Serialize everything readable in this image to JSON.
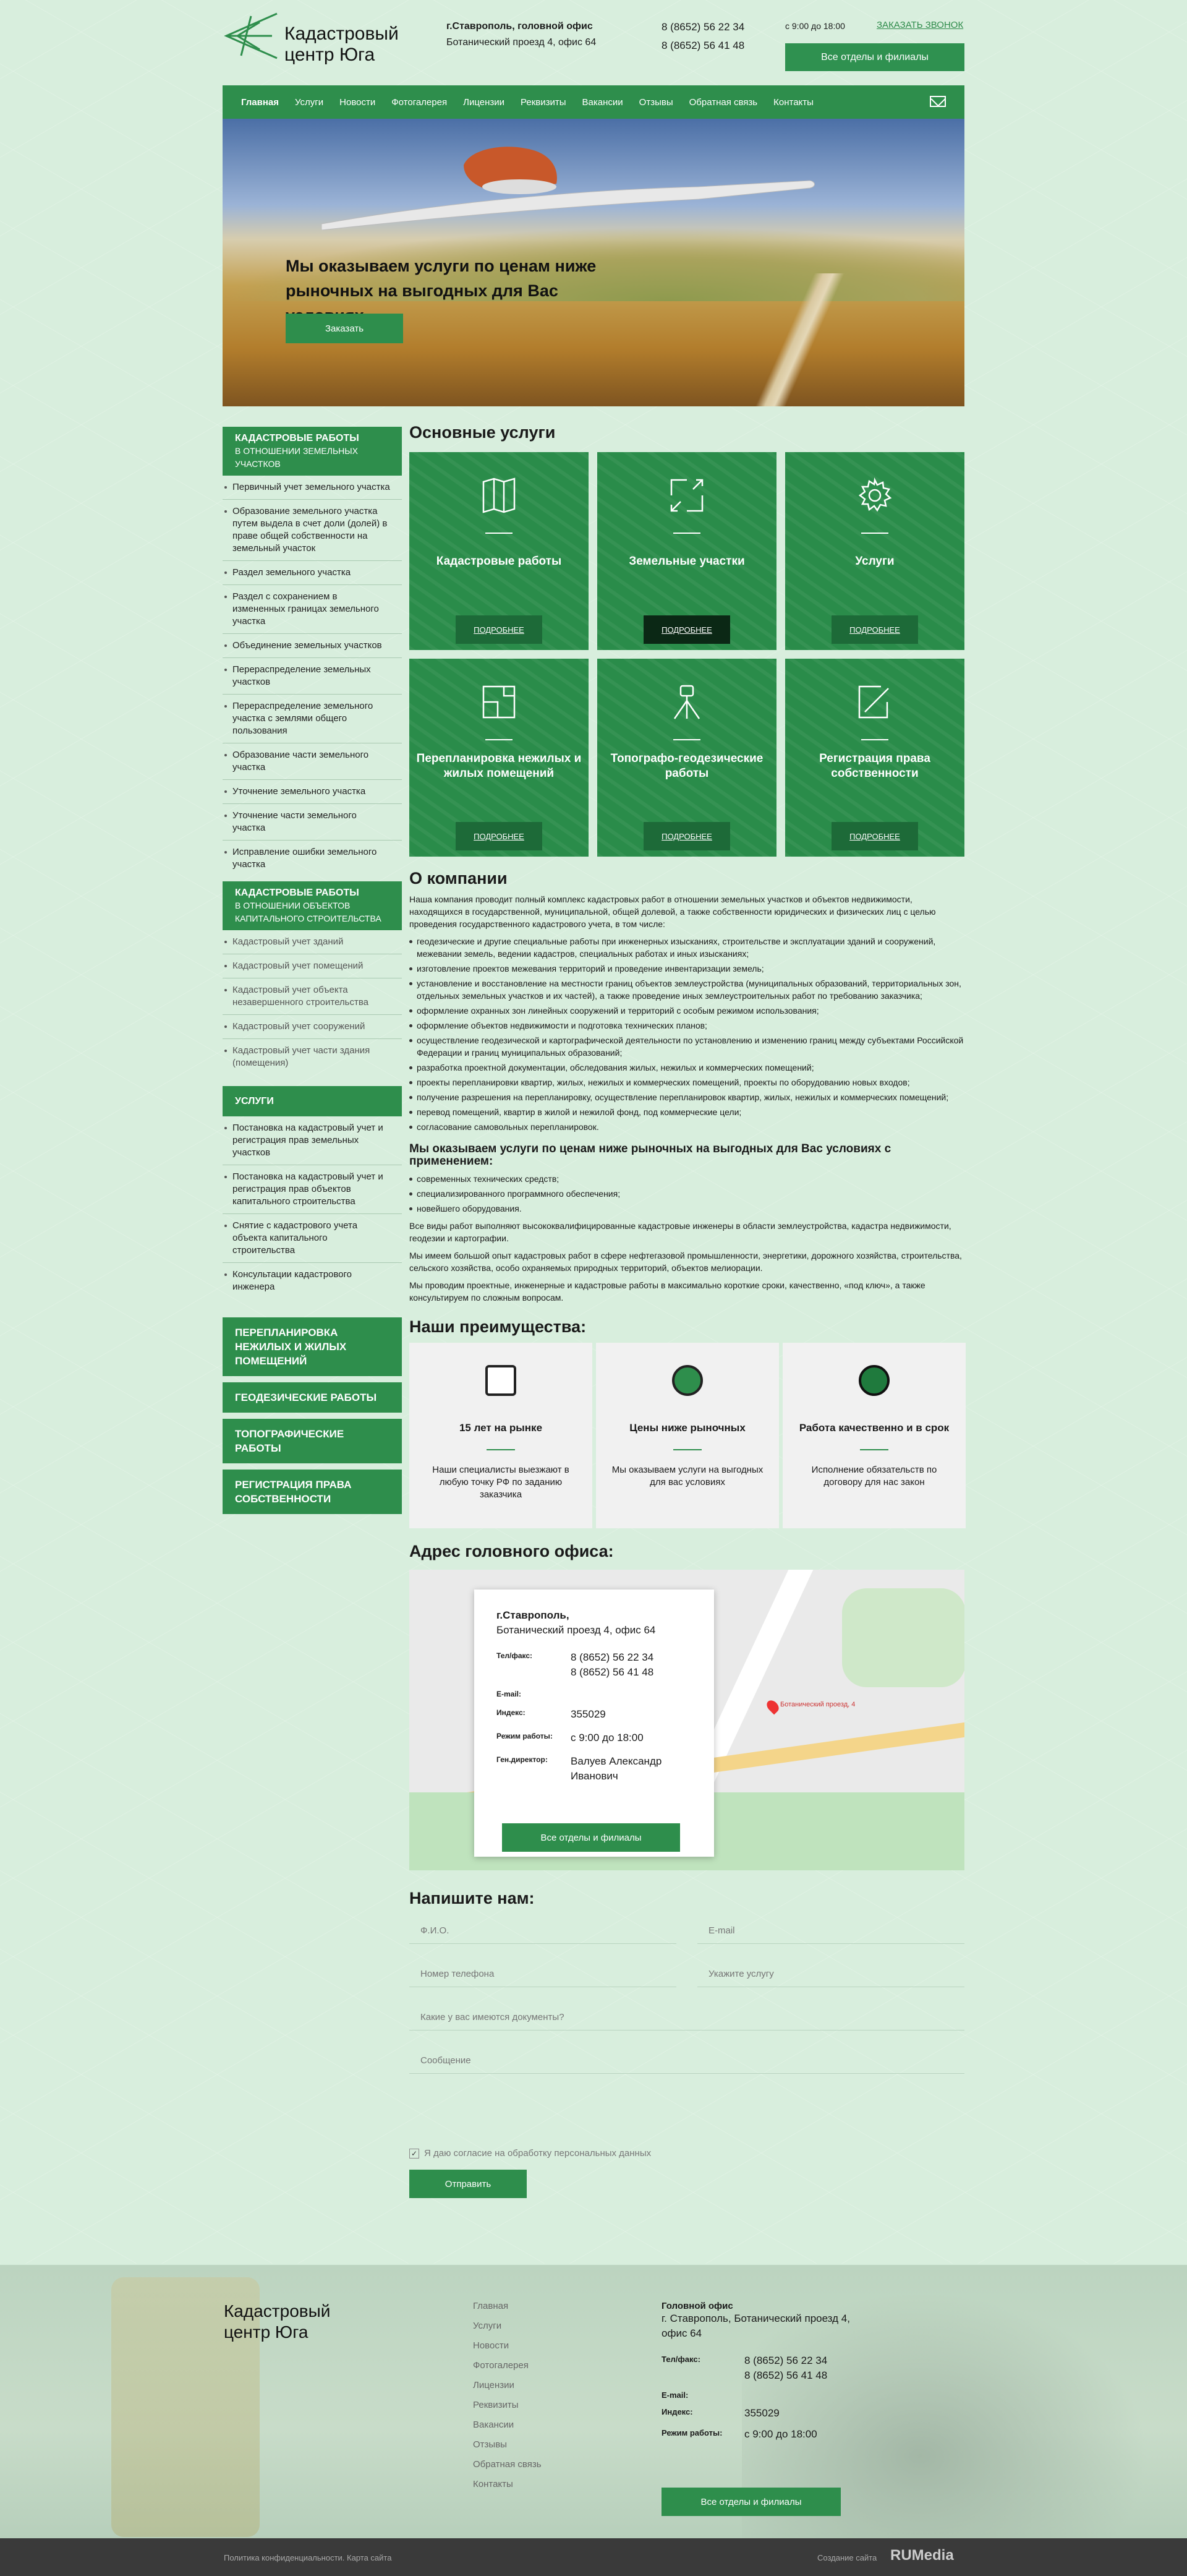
{
  "header": {
    "logo_line1": "Кадастровый",
    "logo_line2": "центр Юга",
    "city": "г.Ставрополь, головной офис",
    "address": "Ботанический проезд 4, офис 64",
    "phone1": "8 (8652) 56 22 34",
    "phone2": "8 (8652) 56 41 48",
    "hours": "с 9:00 до 18:00",
    "call_link": "ЗАКАЗАТЬ ЗВОНОК",
    "branches_button": "Все отделы и филиалы"
  },
  "nav": [
    "Главная",
    "Услуги",
    "Новости",
    "Фотогалерея",
    "Лицензии",
    "Реквизиты",
    "Вакансии",
    "Отзывы",
    "Обратная связь",
    "Контакты"
  ],
  "hero": {
    "text": "Мы оказываем услуги по ценам ниже рыночных на выгодных для Вас условиях",
    "button": "Заказать"
  },
  "sidebar": {
    "group1_title": "Кадастровые работы",
    "group1_sub": "в отношении земельных участков",
    "group1_items": [
      "Первичный учет земельного участка",
      "Образование земельного участка путем выдела в счет доли (долей) в праве общей собственности на земельный участок",
      "Раздел земельного участка",
      "Раздел с сохранением в измененных границах земельного участка",
      "Объединение земельных участков",
      "Перераспределение земельных участков",
      "Перераспределение земельного участка с землями общего пользования",
      "Образование части земельного участка",
      "Уточнение земельного участка",
      "Уточнение части земельного участка",
      "Исправление ошибки земельного участка"
    ],
    "group2_title": "Кадастровые работы",
    "group2_sub": "в отношении объектов капитального строительства",
    "group2_items": [
      "Кадастровый учет зданий",
      "Кадастровый учет помещений",
      "Кадастровый учет объекта незавершенного строительства",
      "Кадастровый учет сооружений",
      "Кадастровый учет части здания (помещения)"
    ],
    "group3_title": "Услуги",
    "group3_items": [
      "Постановка на кадастровый учет и регистрация прав земельных участков",
      "Постановка на кадастровый учет и регистрация прав объектов капитального строительства",
      "Снятие с кадастрового учета объекта капитального строительства",
      "Консультации кадастрового инженера"
    ],
    "big_links": [
      "Перепланировка нежилых и жилых помещений",
      "Геодезические работы",
      "Топографические работы",
      "Регистрация права собственности"
    ]
  },
  "services": {
    "title": "Основные услуги",
    "more": "ПОДРОБНЕЕ",
    "cards": [
      {
        "title": "Кадастровые работы",
        "icon": "map-icon"
      },
      {
        "title": "Земельные участки",
        "icon": "plot-arrows-icon"
      },
      {
        "title": "Услуги",
        "icon": "gear-icon"
      },
      {
        "title": "Перепланировка нежилых и жилых помещений",
        "icon": "floorplan-icon"
      },
      {
        "title": "Топографо-геодезические работы",
        "icon": "theodolite-icon"
      },
      {
        "title": "Регистрация права собственности",
        "icon": "document-pen-icon"
      }
    ]
  },
  "about": {
    "title": "О компании",
    "intro": "Наша компания проводит полный комплекс кадастровых работ в отношении земельных участков и объектов недвижимости, находящихся в государственной, муниципальной, общей долевой, а также собственности юридических и физических лиц с целью проведения государственного кадастрового учета, в том числе:",
    "list1": [
      "геодезические и другие специальные работы при инженерных изысканиях, строительстве и эксплуатации зданий и сооружений, межевании земель, ведении кадастров, специальных работах и иных изысканиях;",
      "изготовление проектов межевания территорий и проведение инвентаризации земель;",
      "установление и восстановление на местности границ объектов землеустройства (муниципальных образований, территориальных зон, отдельных земельных участков и их частей), а также проведение иных землеустроительных работ по требованию заказчика;",
      "оформление охранных зон линейных сооружений и территорий с особым режимом использования;",
      "оформление объектов недвижимости и подготовка технических планов;",
      "осуществление геодезической и картографической деятельности по установлению и изменению границ между субъектами Российской Федерации и границ муниципальных образований;",
      "разработка проектной документации, обследования жилых, нежилых и коммерческих помещений;",
      "проекты перепланировки квартир, жилых, нежилых и коммерческих помещений, проекты по оборудованию новых входов;",
      "получение разрешения на перепланировку, осуществление перепланировок квартир, жилых, нежилых и коммерческих помещений;",
      "перевод помещений, квартир в жилой и нежилой фонд, под коммерческие цели;",
      "согласование самовольных перепланировок."
    ],
    "subtitle": "Мы оказываем услуги по ценам ниже рыночных на выгодных для Вас условиях с применением:",
    "list2": [
      "современных технических средств;",
      "специализированного программного обеспечения;",
      "новейшего оборудования."
    ],
    "p1": "Все виды работ выполняют высококвалифицированные кадастровые инженеры в области землеустройства, кадастра недвижимости, геодезии и картографии.",
    "p2": "Мы имеем большой опыт кадастровых работ в сфере нефтегазовой промышленности, энергетики, дорожного хозяйства, строительства, сельского хозяйства, особо охраняемых природных территорий, объектов мелиорации.",
    "p3": "Мы проводим проектные, инженерные и кадастровые работы в максимально короткие сроки, качественно, «под ключ», а также консультируем по сложным вопросам."
  },
  "advantages": {
    "title": "Наши преимущества:",
    "items": [
      {
        "title": "15 лет на рынке",
        "desc": "Наши специалисты выезжают в любую точку РФ по заданию заказчика",
        "icon": "calendar-icon"
      },
      {
        "title": "Цены ниже рыночных",
        "desc": "Мы оказываем услуги на выгодных для вас условиях",
        "icon": "calculator-icon"
      },
      {
        "title": "Работа качественно и в срок",
        "desc": "Исполнение обязательств по договору для нас закон",
        "icon": "clock-icon"
      }
    ]
  },
  "office": {
    "title": "Адрес головного офиса:",
    "city": "г.Ставрополь,",
    "address": "Ботанический проезд 4, офис 64",
    "phone_label": "Тел/факс:",
    "phone1": "8 (8652) 56 22 34",
    "phone2": "8 (8652) 56 41 48",
    "email_label": "E-mail:",
    "index_label": "Индекс:",
    "index": "355029",
    "hours_label": "Режим работы:",
    "hours": "с 9:00 до 18:00",
    "director_label": "Ген.директор:",
    "director": "Валуев Александр Иванович",
    "button": "Все отделы и филиалы",
    "map_label": "Ботанический проезд, 4"
  },
  "form": {
    "title": "Напишите нам:",
    "name_ph": "Ф.И.О.",
    "email_ph": "E-mail",
    "phone_ph": "Номер телефона",
    "service_ph": "Укажите услугу",
    "docs_ph": "Какие у вас имеются документы?",
    "message_ph": "Сообщение",
    "consent": "Я даю согласие на обработку персональных данных",
    "submit": "Отправить"
  },
  "footer": {
    "logo_line1": "Кадастровый",
    "logo_line2": "центр Юга",
    "nav": [
      "Главная",
      "Услуги",
      "Новости",
      "Фотогалерея",
      "Лицензии",
      "Реквизиты",
      "Вакансии",
      "Отзывы",
      "Обратная связь",
      "Контакты"
    ],
    "office_title": "Головной офис",
    "office_address": "г. Ставрополь, Ботанический проезд 4, офис 64",
    "phone_label": "Тел/факс:",
    "phone1": "8 (8652) 56 22 34",
    "phone2": "8 (8652) 56 41 48",
    "email_label": "E-mail:",
    "index_label": "Индекс:",
    "index": "355029",
    "hours_label": "Режим работы:",
    "hours": "с 9:00 до 18:00",
    "button": "Все отделы и филиалы",
    "privacy": "Политика конфиденциальности",
    "sitemap": "Карта сайта",
    "created": "Создание сайта",
    "agency": "RUMedia"
  }
}
